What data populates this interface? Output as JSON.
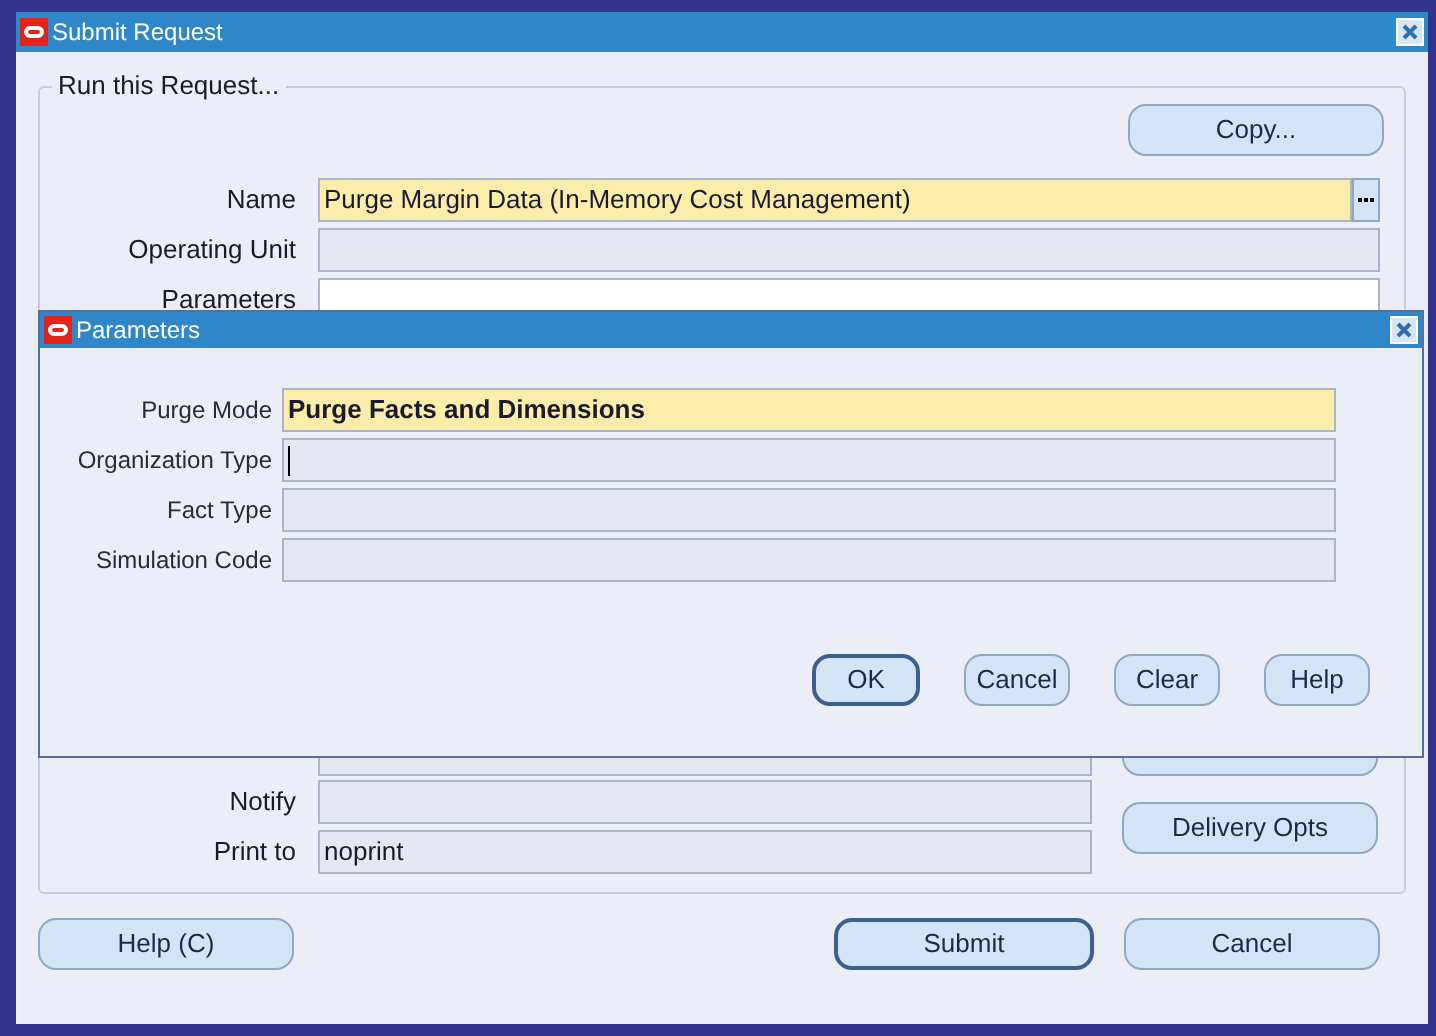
{
  "window": {
    "title": "Submit Request"
  },
  "group": {
    "title": "Run this Request..."
  },
  "copy_button": "Copy...",
  "fields": [
    {
      "label": "Name",
      "value": "Purge Margin Data (In-Memory Cost Management)",
      "kind": "required"
    },
    {
      "label": "Operating Unit",
      "kind": "readonly"
    },
    {
      "label": "Parameters",
      "kind": "editable"
    }
  ],
  "lower_fields": [
    {
      "label": "Notify"
    },
    {
      "label": "Print to",
      "value": "noprint"
    }
  ],
  "delivery_button": "Delivery Opts",
  "footer_buttons": [
    {
      "label": "Help (C)",
      "default": false
    },
    {
      "label": "Submit",
      "default": true
    },
    {
      "label": "Cancel",
      "default": false
    }
  ],
  "dialog": {
    "title": "Parameters",
    "fields": [
      {
        "label": "Purge Mode",
        "value": "Purge Facts and Dimensions",
        "kind": "required"
      },
      {
        "label": "Organization Type",
        "kind": "focused"
      },
      {
        "label": "Fact Type",
        "kind": "readonly"
      },
      {
        "label": "Simulation Code",
        "kind": "readonly"
      }
    ],
    "buttons": [
      {
        "label": "OK",
        "default": true
      },
      {
        "label": "Cancel",
        "default": false
      },
      {
        "label": "Clear",
        "default": false
      },
      {
        "label": "Help",
        "default": false
      }
    ]
  }
}
